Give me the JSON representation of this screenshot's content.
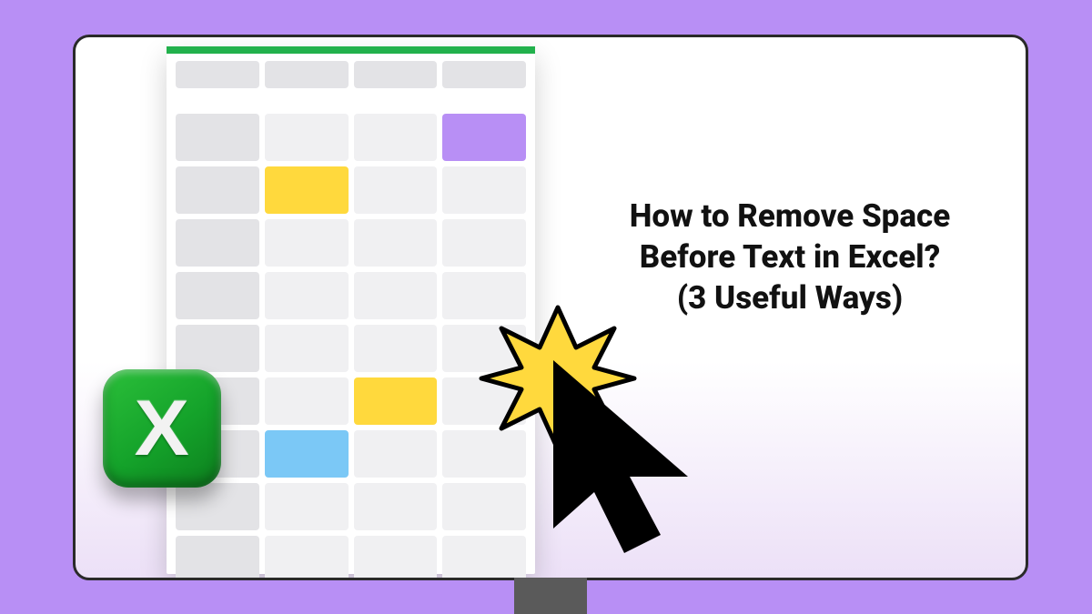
{
  "title": {
    "line1": "How to Remove Space",
    "line2": "Before Text in Excel?",
    "line3": "(3 Useful Ways)"
  },
  "excel_icon": {
    "letter": "X"
  },
  "sheet": {
    "columns": 4,
    "rows": 9,
    "highlight_cells": [
      {
        "row": 1,
        "col": 3,
        "color": "purple"
      },
      {
        "row": 2,
        "col": 1,
        "color": "yellow"
      },
      {
        "row": 6,
        "col": 2,
        "color": "yellow"
      },
      {
        "row": 7,
        "col": 1,
        "color": "blue"
      }
    ]
  },
  "colors": {
    "background": "#B88FF5",
    "accent_green": "#22B14C",
    "yellow": "#FFD93D",
    "purple": "#B88FF5",
    "blue": "#7BC8F6"
  }
}
